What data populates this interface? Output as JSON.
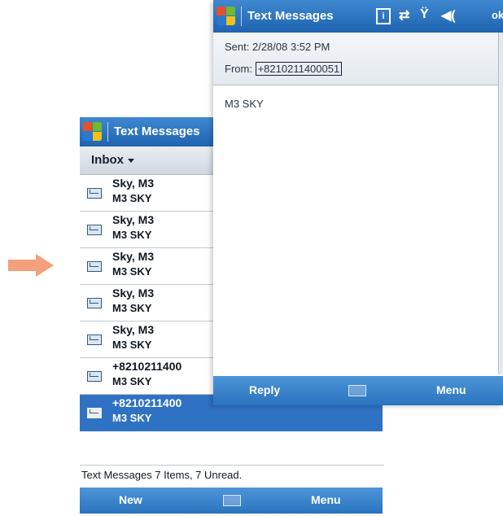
{
  "inbox_window": {
    "title": "Text Messages",
    "folder_label": "Inbox",
    "messages": [
      {
        "sender": "Sky, M3",
        "preview": "M3 SKY"
      },
      {
        "sender": "Sky, M3",
        "preview": "M3 SKY"
      },
      {
        "sender": "Sky, M3",
        "preview": "M3 SKY"
      },
      {
        "sender": "Sky, M3",
        "preview": "M3 SKY"
      },
      {
        "sender": "Sky, M3",
        "preview": "M3 SKY"
      },
      {
        "sender": "+8210211400",
        "preview": "M3 SKY"
      },
      {
        "sender": "+8210211400",
        "preview": "M3 SKY"
      }
    ],
    "status": "Text Messages  7 Items, 7 Unread.",
    "softkeys": {
      "left": "New",
      "right": "Menu"
    }
  },
  "message_window": {
    "title": "Text Messages",
    "sent_label": "Sent:",
    "sent_value": "2/28/08 3:52 PM",
    "from_label": "From:",
    "from_value": "+8210211400051",
    "body": "M3 SKY",
    "softkeys": {
      "left": "Reply",
      "right": "Menu"
    },
    "status_icons": [
      "info-icon",
      "sync-icon",
      "signal-icon",
      "speaker-icon",
      "ok"
    ]
  },
  "colors": {
    "titlebar": "#2a73bf",
    "selection": "#2f72c4",
    "arrow": "#f4a07c"
  }
}
